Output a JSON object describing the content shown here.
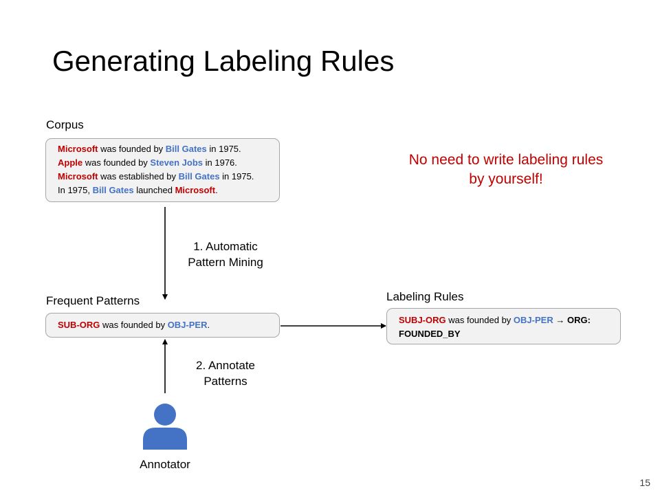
{
  "slide": {
    "title": "Generating Labeling Rules",
    "page_number": "15"
  },
  "corpus": {
    "label": "Corpus",
    "sentences": [
      [
        {
          "t": "Microsoft",
          "s": "org"
        },
        {
          "t": " was founded by ",
          "s": "plain"
        },
        {
          "t": "Bill Gates",
          "s": "per"
        },
        {
          "t": " in 1975.",
          "s": "plain"
        }
      ],
      [
        {
          "t": "Apple",
          "s": "org"
        },
        {
          "t": " was founded by ",
          "s": "plain"
        },
        {
          "t": "Steven Jobs",
          "s": "per"
        },
        {
          "t": " in 1976.",
          "s": "plain"
        }
      ],
      [
        {
          "t": "Microsoft",
          "s": "org"
        },
        {
          "t": " was established by ",
          "s": "plain"
        },
        {
          "t": "Bill Gates",
          "s": "per"
        },
        {
          "t": " in 1975.",
          "s": "plain"
        }
      ],
      [
        {
          "t": "In 1975, ",
          "s": "plain"
        },
        {
          "t": "Bill Gates",
          "s": "per"
        },
        {
          "t": " launched ",
          "s": "plain"
        },
        {
          "t": "Microsoft",
          "s": "org"
        },
        {
          "t": ".",
          "s": "plain"
        }
      ]
    ]
  },
  "step1": {
    "line1": "1. Automatic",
    "line2": "Pattern Mining"
  },
  "patterns": {
    "label": "Frequent Patterns",
    "items": [
      [
        {
          "t": "SUB-ORG",
          "s": "org"
        },
        {
          "t": " was founded by ",
          "s": "plain"
        },
        {
          "t": "OBJ-PER",
          "s": "per"
        },
        {
          "t": ".",
          "s": "plain"
        }
      ]
    ]
  },
  "rules": {
    "label": "Labeling Rules",
    "items": [
      [
        {
          "t": "SUBJ-ORG",
          "s": "org"
        },
        {
          "t": " was founded by ",
          "s": "plain"
        },
        {
          "t": "OBJ-PER",
          "s": "per"
        },
        {
          "t": " → ",
          "s": "plain"
        },
        {
          "t": "ORG:",
          "s": "bold"
        }
      ],
      [
        {
          "t": "FOUNDED_BY",
          "s": "bold"
        }
      ]
    ]
  },
  "step2": {
    "line1": "2. Annotate",
    "line2": "Patterns"
  },
  "annotator": {
    "label": "Annotator"
  },
  "note": {
    "line1": "No need to write labeling rules",
    "line2": "by yourself!"
  },
  "colors": {
    "org": "#c00000",
    "per": "#4472c4",
    "accent": "#c00000",
    "box_fill": "#f2f2f2",
    "box_border": "#a6a6a6",
    "person_icon": "#4472c4"
  }
}
